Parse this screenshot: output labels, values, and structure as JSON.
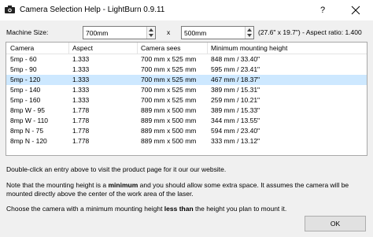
{
  "window": {
    "title": "Camera Selection Help - LightBurn 0.9.11",
    "help_label": "?",
    "close_icon": "close-icon",
    "app_icon": "camera-icon"
  },
  "machine_size": {
    "label": "Machine Size:",
    "width": "700mm",
    "separator": "x",
    "height": "500mm",
    "aspect_text": "(27.6\" x 19.7\") - Aspect ratio: 1.400"
  },
  "table": {
    "columns": [
      "Camera",
      "Aspect",
      "Camera sees",
      "Minimum mounting height"
    ],
    "selected_index": 2,
    "rows": [
      [
        "5mp - 60",
        "1.333",
        "700 mm x 525 mm",
        "848 mm / 33.40\""
      ],
      [
        "5mp - 90",
        "1.333",
        "700 mm x 525 mm",
        "595 mm / 23.41\""
      ],
      [
        "5mp - 120",
        "1.333",
        "700 mm x 525 mm",
        "467 mm / 18.37\""
      ],
      [
        "5mp - 140",
        "1.333",
        "700 mm x 525 mm",
        "389 mm / 15.31\""
      ],
      [
        "5mp - 160",
        "1.333",
        "700 mm x 525 mm",
        "259 mm / 10.21\""
      ],
      [
        "8mp W - 95",
        "1.778",
        "889 mm x 500 mm",
        "389 mm / 15.33\""
      ],
      [
        "8mp W - 110",
        "1.778",
        "889 mm x 500 mm",
        "344 mm / 13.55\""
      ],
      [
        "8mp N - 75",
        "1.778",
        "889 mm x 500 mm",
        "594 mm / 23.40\""
      ],
      [
        "8mp N - 120",
        "1.778",
        "889 mm x 500 mm",
        "333 mm / 13.12\""
      ]
    ]
  },
  "info": {
    "p1": "Double-click an entry above to visit the product page for it our our website.",
    "p2_before": "Note that the mounting height is a ",
    "p2_bold": "minimum",
    "p2_after": " and you should allow some extra space. It assumes the camera will be mounted directly above the center of the work area of the laser.",
    "p3_before": "Choose the camera with a minimum mounting height ",
    "p3_bold": "less than",
    "p3_after": " the height you plan to mount it."
  },
  "ok_label": "OK"
}
